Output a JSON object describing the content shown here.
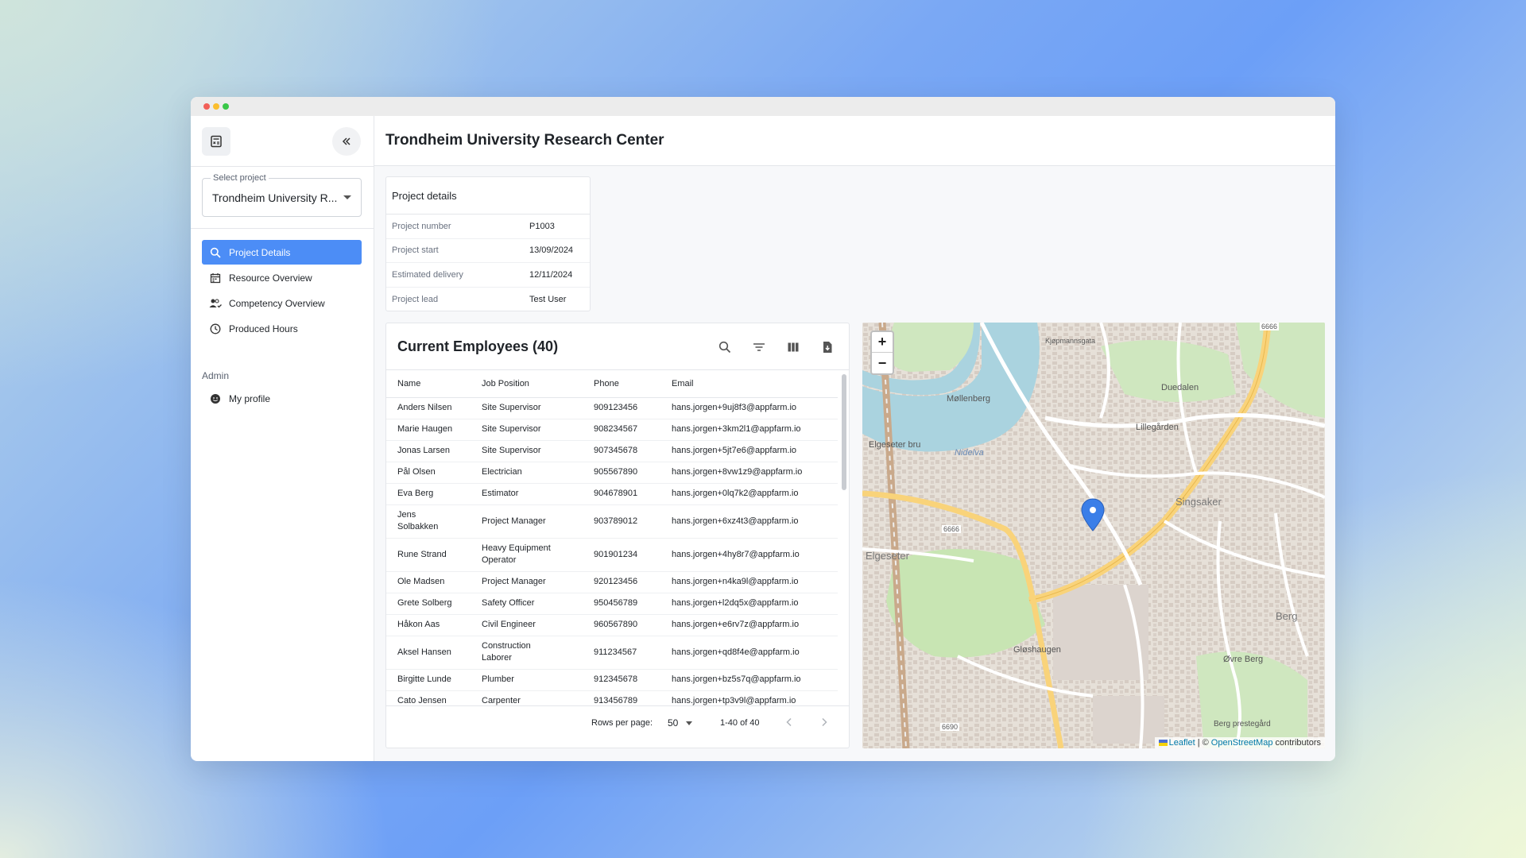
{
  "window": {
    "title": "Trondheim University Research Center"
  },
  "sidebar": {
    "select_label": "Select project",
    "select_value": "Trondheim University R...",
    "items": [
      {
        "label": "Project Details",
        "icon": "search-icon",
        "active": true
      },
      {
        "label": "Resource Overview",
        "icon": "calendar-icon",
        "active": false
      },
      {
        "label": "Competency Overview",
        "icon": "people-check-icon",
        "active": false
      },
      {
        "label": "Produced Hours",
        "icon": "clock-icon",
        "active": false
      }
    ],
    "admin_label": "Admin",
    "admin_items": [
      {
        "label": "My profile",
        "icon": "smiley-icon"
      }
    ]
  },
  "details": {
    "title": "Project details",
    "rows": [
      {
        "key": "Project number",
        "value": "P1003"
      },
      {
        "key": "Project start",
        "value": "13/09/2024"
      },
      {
        "key": "Estimated delivery",
        "value": "12/11/2024"
      },
      {
        "key": "Project lead",
        "value": "Test User"
      }
    ]
  },
  "employees": {
    "title": "Current Employees (40)",
    "columns": [
      "Name",
      "Job Position",
      "Phone",
      "Email"
    ],
    "rows": [
      [
        "Anders Nilsen",
        "Site Supervisor",
        "909123456",
        "hans.jorgen+9uj8f3@appfarm.io"
      ],
      [
        "Marie Haugen",
        "Site Supervisor",
        "908234567",
        "hans.jorgen+3km2l1@appfarm.io"
      ],
      [
        "Jonas Larsen",
        "Site Supervisor",
        "907345678",
        "hans.jorgen+5jt7e6@appfarm.io"
      ],
      [
        "Pål Olsen",
        "Electrician",
        "905567890",
        "hans.jorgen+8vw1z9@appfarm.io"
      ],
      [
        "Eva Berg",
        "Estimator",
        "904678901",
        "hans.jorgen+0lq7k2@appfarm.io"
      ],
      [
        "Jens Solbakken",
        "Project Manager",
        "903789012",
        "hans.jorgen+6xz4t3@appfarm.io"
      ],
      [
        "Rune Strand",
        "Heavy Equipment Operator",
        "901901234",
        "hans.jorgen+4hy8r7@appfarm.io"
      ],
      [
        "Ole Madsen",
        "Project Manager",
        "920123456",
        "hans.jorgen+n4ka9l@appfarm.io"
      ],
      [
        "Grete Solberg",
        "Safety Officer",
        "950456789",
        "hans.jorgen+l2dq5x@appfarm.io"
      ],
      [
        "Håkon Aas",
        "Civil Engineer",
        "960567890",
        "hans.jorgen+e6rv7z@appfarm.io"
      ],
      [
        "Aksel Hansen",
        "Construction Laborer",
        "911234567",
        "hans.jorgen+qd8f4e@appfarm.io"
      ],
      [
        "Birgitte Lunde",
        "Plumber",
        "912345678",
        "hans.jorgen+bz5s7q@appfarm.io"
      ],
      [
        "Cato Jensen",
        "Carpenter",
        "913456789",
        "hans.jorgen+tp3v9l@appfarm.io"
      ]
    ],
    "rows_per_page_label": "Rows per page:",
    "rows_per_page_value": "50",
    "range_text": "1-40 of 40"
  },
  "map": {
    "zoom_in": "+",
    "zoom_out": "−",
    "attribution_leaflet": "Leaflet",
    "attribution_sep": "| ©",
    "attribution_osm": "OpenStreetMap",
    "attribution_suffix": "contributors",
    "labels": [
      "Elgeseter bru",
      "Singsaker",
      "Elgeseter",
      "Berg",
      "Gløshaugen",
      "Møllenberg",
      "Lillegården",
      "Duedalen",
      "Nidelva",
      "Kjøpmannsgata",
      "Øvre Berg",
      "Berg prestegård"
    ],
    "road_numbers": [
      "6666",
      "6690"
    ],
    "colors": {
      "water": "#aad3df",
      "park": "#c8e5b3",
      "road_major": "#f9d37a",
      "building": "#d9d0c9",
      "marker": "#3a7ee8"
    }
  },
  "colors": {
    "accent": "#4c8df6"
  }
}
